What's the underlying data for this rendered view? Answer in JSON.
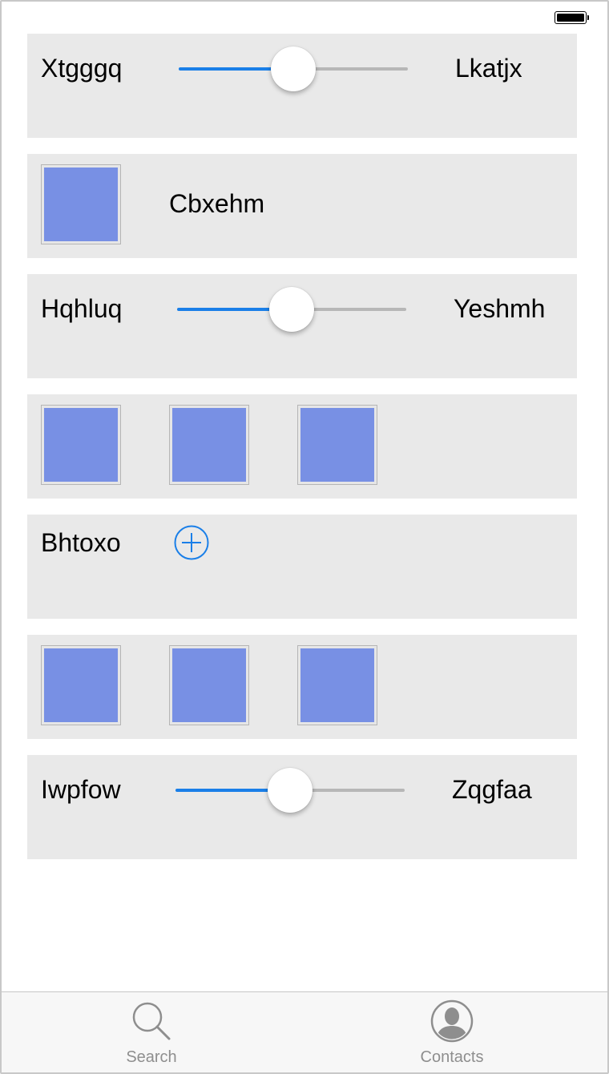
{
  "status_bar": {
    "battery_icon": "battery-full-icon"
  },
  "rows": [
    {
      "type": "slider",
      "left_label": "Xtgggq",
      "right_label": "Lkatjx",
      "value": 0.5
    },
    {
      "type": "swatch-label",
      "label": "Cbxehm",
      "swatch_color": "#7890e4"
    },
    {
      "type": "slider",
      "left_label": "Hqhluq",
      "right_label": "Yeshmh",
      "value": 0.5
    },
    {
      "type": "swatches",
      "count": 3,
      "swatch_color": "#7890e4"
    },
    {
      "type": "label-button",
      "label": "Bhtoxo",
      "button_icon": "plus-circle-icon"
    },
    {
      "type": "swatches",
      "count": 3,
      "swatch_color": "#7890e4"
    },
    {
      "type": "slider",
      "left_label": "Iwpfow",
      "right_label": "Zqgfaa",
      "value": 0.5
    }
  ],
  "tabbar": {
    "tabs": [
      {
        "label": "Search",
        "icon": "search-icon"
      },
      {
        "label": "Contacts",
        "icon": "contact-avatar-icon"
      }
    ]
  },
  "colors": {
    "accent": "#1a7fe8",
    "swatch": "#7890e4",
    "row_background": "#e9e9e9",
    "tab_label": "#8e8e8e"
  }
}
